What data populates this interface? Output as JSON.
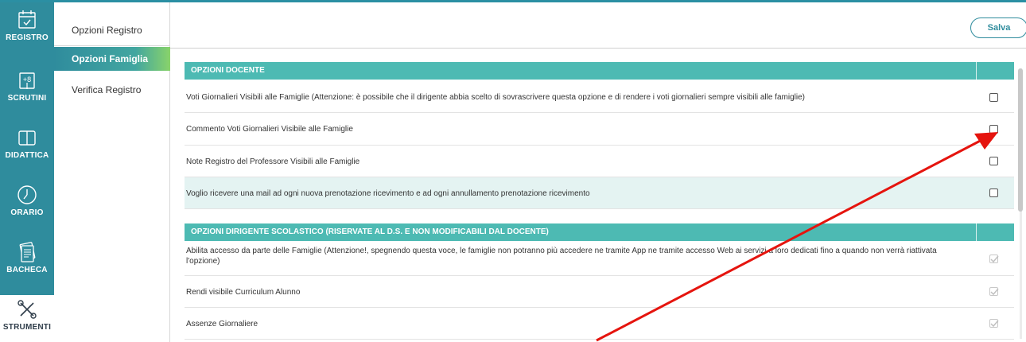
{
  "rail": {
    "items": [
      {
        "label": "REGISTRO",
        "icon": "calendar-check-icon"
      },
      {
        "label": "SCRUTINI",
        "icon": "scrutini-icon"
      },
      {
        "label": "DIDATTICA",
        "icon": "book-icon"
      },
      {
        "label": "ORARIO",
        "icon": "clock-icon"
      },
      {
        "label": "BACHECA",
        "icon": "notes-icon"
      },
      {
        "label": "STRUMENTI",
        "icon": "tools-icon"
      }
    ]
  },
  "submenu": {
    "items": [
      {
        "label": "Opzioni Registro"
      },
      {
        "label": "Opzioni Famiglia"
      },
      {
        "label": "Verifica Registro"
      }
    ],
    "active": "Opzioni Famiglia"
  },
  "header": {
    "save_label": "Salva"
  },
  "sections": [
    {
      "title": "OPZIONI DOCENTE",
      "rows": [
        {
          "text": "Voti Giornalieri Visibili alle Famiglie (Attenzione: è possibile che il dirigente abbia scelto di sovrascrivere questa opzione e di rendere i voti giornalieri sempre visibili alle famiglie)",
          "checked": false
        },
        {
          "text": "Commento Voti Giornalieri Visibile alle Famiglie",
          "checked": false
        },
        {
          "text": "Note Registro del Professore Visibili alle Famiglie",
          "checked": false
        },
        {
          "text": "Voglio ricevere una mail ad ogni nuova prenotazione ricevimento e ad ogni annullamento prenotazione ricevimento",
          "checked": false
        }
      ]
    },
    {
      "title": "OPZIONI DIRIGENTE SCOLASTICO (RISERVATE AL D.S. E NON MODIFICABILI DAL DOCENTE)",
      "rows": [
        {
          "text": "Abilita accesso da parte delle Famiglie (Attenzione!, spegnendo questa voce, le famiglie non potranno più accedere ne tramite App ne tramite accesso Web ai servizi a loro dedicati fino a quando non verrà riattivata l'opzione)",
          "checked": true
        },
        {
          "text": "Rendi visibile Curriculum Alunno",
          "checked": true
        },
        {
          "text": "Assenze Giornaliere",
          "checked": true
        }
      ]
    }
  ],
  "colors": {
    "primary": "#2f8c9d",
    "section_header": "#4dbab3",
    "annotation_arrow": "#e5140e"
  }
}
